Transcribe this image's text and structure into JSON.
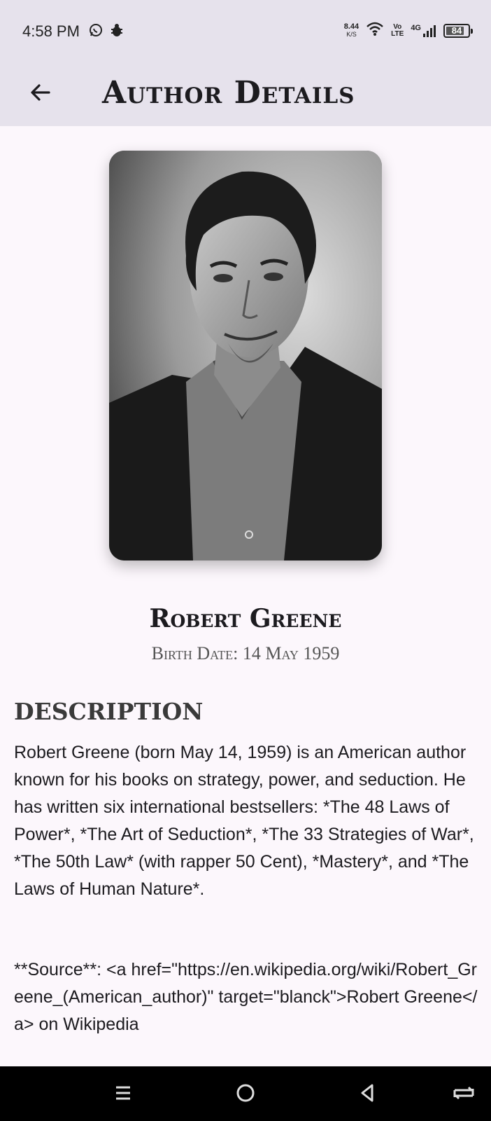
{
  "status_bar": {
    "time": "4:58 PM",
    "net_speed_value": "8.44",
    "net_speed_unit": "K/S",
    "volte_top": "Vo",
    "volte_bottom": "LTE",
    "network": "4G",
    "battery": "84",
    "battery_level_percent": 84
  },
  "app_bar": {
    "title": "Author Details"
  },
  "author": {
    "name": "Robert Greene",
    "birth_date": "Birth Date: 14 May 1959"
  },
  "description": {
    "heading": "DESCRIPTION",
    "body": "Robert Greene (born May 14, 1959) is an American author known for his books on strategy, power, and seduction. He has written six international bestsellers: *The 48 Laws of Power*, *The Art of Seduction*, *The 33 Strategies of War*, *The 50th Law* (with rapper 50 Cent), *Mastery*, and *The Laws of Human Nature*.",
    "source": "**Source**: <a href=\"https://en.wikipedia.org/wiki/Robert_Greene_(American_author)\" target=\"blanck\">Robert Greene</a> on Wikipedia"
  },
  "colors": {
    "app_bar_bg": "#e6e2ec",
    "page_bg": "#fcf7fc",
    "nav_bar_bg": "#000000"
  },
  "icons": {
    "back": "arrow-left-icon",
    "whatsapp": "whatsapp-icon",
    "bug": "bug-icon",
    "wifi": "wifi-icon",
    "signal": "signal-icon",
    "nav_menu": "recent-apps-icon",
    "nav_home": "home-icon",
    "nav_back": "back-triangle-icon",
    "nav_rotate": "rotate-icon"
  }
}
